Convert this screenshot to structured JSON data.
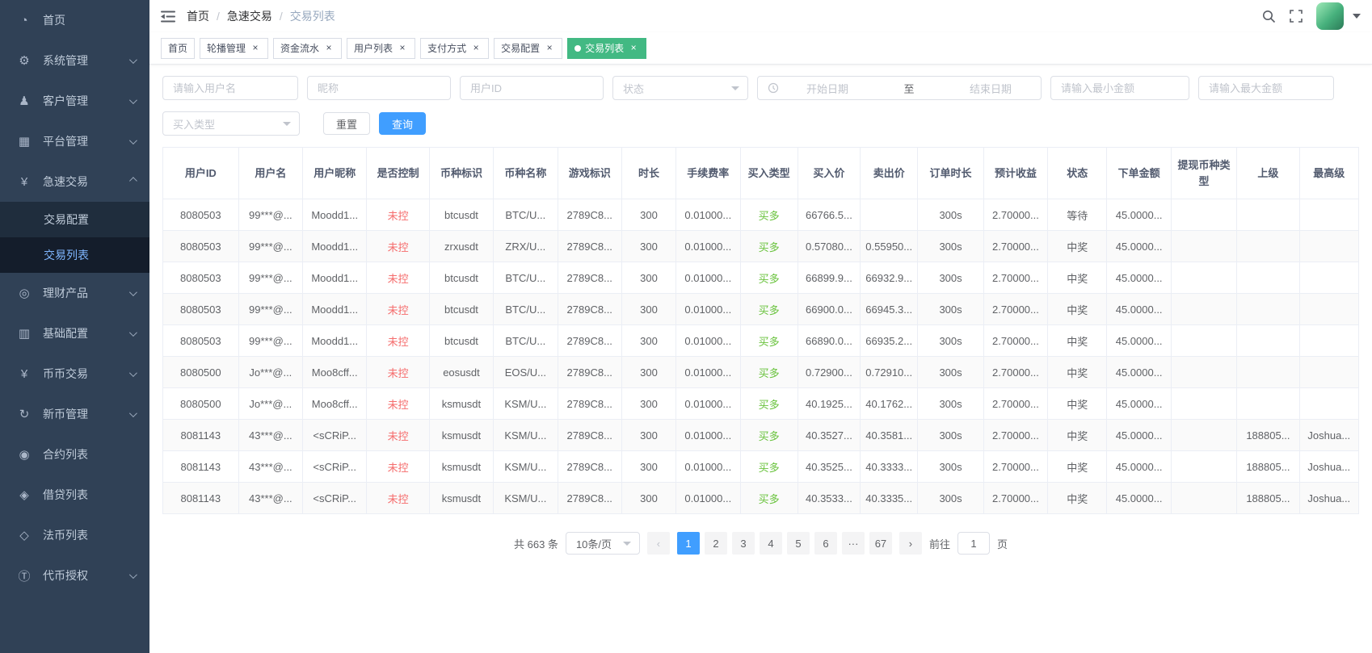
{
  "colors": {
    "primary": "#409EFF",
    "success": "#67C23A",
    "danger": "#F56C6C",
    "tag_active": "#42b983",
    "sidebar_bg": "#304156"
  },
  "sidebar": {
    "items": [
      {
        "label": "首页",
        "icon": "dashboard-icon",
        "glyph": "◔"
      },
      {
        "label": "系统管理",
        "icon": "gear-icon",
        "glyph": "⚙",
        "arrow": "down"
      },
      {
        "label": "客户管理",
        "icon": "user-icon",
        "glyph": "♟",
        "arrow": "down"
      },
      {
        "label": "平台管理",
        "icon": "grid-icon",
        "glyph": "▦",
        "arrow": "down"
      },
      {
        "label": "急速交易",
        "icon": "yen-icon",
        "glyph": "¥",
        "arrow": "up",
        "expanded": true,
        "children": [
          {
            "label": "交易配置",
            "active": false
          },
          {
            "label": "交易列表",
            "active": true
          }
        ]
      },
      {
        "label": "理财产品",
        "icon": "product-icon",
        "glyph": "◎",
        "arrow": "down"
      },
      {
        "label": "基础配置",
        "icon": "config-icon",
        "glyph": "▥",
        "arrow": "down"
      },
      {
        "label": "币币交易",
        "icon": "coin-trade-icon",
        "glyph": "¥",
        "arrow": "down"
      },
      {
        "label": "新币管理",
        "icon": "new-coin-icon",
        "glyph": "↻",
        "arrow": "down"
      },
      {
        "label": "合约列表",
        "icon": "contract-icon",
        "glyph": "◉"
      },
      {
        "label": "借贷列表",
        "icon": "loan-icon",
        "glyph": "◈"
      },
      {
        "label": "法币列表",
        "icon": "fiat-icon",
        "glyph": "◇"
      },
      {
        "label": "代币授权",
        "icon": "token-icon",
        "glyph": "Ⓣ",
        "arrow": "down"
      }
    ]
  },
  "header": {
    "breadcrumb": [
      "首页",
      "急速交易",
      "交易列表"
    ],
    "breadcrumb_separator": "/",
    "icons": [
      "hamburger-icon",
      "search-icon",
      "fullscreen-icon",
      "avatar",
      "caret-down-icon"
    ]
  },
  "tags": [
    {
      "label": "首页",
      "closable": false,
      "active": false
    },
    {
      "label": "轮播管理",
      "closable": true,
      "active": false
    },
    {
      "label": "资金流水",
      "closable": true,
      "active": false
    },
    {
      "label": "用户列表",
      "closable": true,
      "active": false
    },
    {
      "label": "支付方式",
      "closable": true,
      "active": false
    },
    {
      "label": "交易配置",
      "closable": true,
      "active": false
    },
    {
      "label": "交易列表",
      "closable": true,
      "active": true
    }
  ],
  "filters": {
    "username_placeholder": "请输入用户名",
    "nickname_placeholder": "昵称",
    "userid_placeholder": "用户ID",
    "status_placeholder": "状态",
    "date_start_placeholder": "开始日期",
    "date_separator": "至",
    "date_end_placeholder": "结束日期",
    "min_amount_placeholder": "请输入最小金额",
    "max_amount_placeholder": "请输入最大金额",
    "buy_type_placeholder": "买入类型",
    "reset_label": "重置",
    "search_label": "查询"
  },
  "table": {
    "columns": [
      "用户ID",
      "用户名",
      "用户昵称",
      "是否控制",
      "币种标识",
      "币种名称",
      "游戏标识",
      "时长",
      "手续费率",
      "买入类型",
      "买入价",
      "卖出价",
      "订单时长",
      "预计收益",
      "状态",
      "下单金额",
      "提现币种类型",
      "上级",
      "最高级"
    ],
    "rows": [
      [
        "8080503",
        "99***@...",
        "Moodd1...",
        "未控",
        "btcusdt",
        "BTC/U...",
        "2789C8...",
        "300",
        "0.01000...",
        "买多",
        "66766.5...",
        "",
        "300s",
        "2.70000...",
        "等待",
        "45.0000...",
        "",
        "",
        ""
      ],
      [
        "8080503",
        "99***@...",
        "Moodd1...",
        "未控",
        "zrxusdt",
        "ZRX/U...",
        "2789C8...",
        "300",
        "0.01000...",
        "买多",
        "0.57080...",
        "0.55950...",
        "300s",
        "2.70000...",
        "中奖",
        "45.0000...",
        "",
        "",
        ""
      ],
      [
        "8080503",
        "99***@...",
        "Moodd1...",
        "未控",
        "btcusdt",
        "BTC/U...",
        "2789C8...",
        "300",
        "0.01000...",
        "买多",
        "66899.9...",
        "66932.9...",
        "300s",
        "2.70000...",
        "中奖",
        "45.0000...",
        "",
        "",
        ""
      ],
      [
        "8080503",
        "99***@...",
        "Moodd1...",
        "未控",
        "btcusdt",
        "BTC/U...",
        "2789C8...",
        "300",
        "0.01000...",
        "买多",
        "66900.0...",
        "66945.3...",
        "300s",
        "2.70000...",
        "中奖",
        "45.0000...",
        "",
        "",
        ""
      ],
      [
        "8080503",
        "99***@...",
        "Moodd1...",
        "未控",
        "btcusdt",
        "BTC/U...",
        "2789C8...",
        "300",
        "0.01000...",
        "买多",
        "66890.0...",
        "66935.2...",
        "300s",
        "2.70000...",
        "中奖",
        "45.0000...",
        "",
        "",
        ""
      ],
      [
        "8080500",
        "Jo***@...",
        "Moo8cff...",
        "未控",
        "eosusdt",
        "EOS/U...",
        "2789C8...",
        "300",
        "0.01000...",
        "买多",
        "0.72900...",
        "0.72910...",
        "300s",
        "2.70000...",
        "中奖",
        "45.0000...",
        "",
        "",
        ""
      ],
      [
        "8080500",
        "Jo***@...",
        "Moo8cff...",
        "未控",
        "ksmusdt",
        "KSM/U...",
        "2789C8...",
        "300",
        "0.01000...",
        "买多",
        "40.1925...",
        "40.1762...",
        "300s",
        "2.70000...",
        "中奖",
        "45.0000...",
        "",
        "",
        ""
      ],
      [
        "8081143",
        "43***@...",
        "<sCRiP...",
        "未控",
        "ksmusdt",
        "KSM/U...",
        "2789C8...",
        "300",
        "0.01000...",
        "买多",
        "40.3527...",
        "40.3581...",
        "300s",
        "2.70000...",
        "中奖",
        "45.0000...",
        "",
        "188805...",
        "Joshua..."
      ],
      [
        "8081143",
        "43***@...",
        "<sCRiP...",
        "未控",
        "ksmusdt",
        "KSM/U...",
        "2789C8...",
        "300",
        "0.01000...",
        "买多",
        "40.3525...",
        "40.3333...",
        "300s",
        "2.70000...",
        "中奖",
        "45.0000...",
        "",
        "188805...",
        "Joshua..."
      ],
      [
        "8081143",
        "43***@...",
        "<sCRiP...",
        "未控",
        "ksmusdt",
        "KSM/U...",
        "2789C8...",
        "300",
        "0.01000...",
        "买多",
        "40.3533...",
        "40.3335...",
        "300s",
        "2.70000...",
        "中奖",
        "45.0000...",
        "",
        "188805...",
        "Joshua..."
      ]
    ]
  },
  "pagination": {
    "total_label": "共 663 条",
    "page_size": "10条/页",
    "prev_glyph": "‹",
    "next_glyph": "›",
    "pages": [
      "1",
      "2",
      "3",
      "4",
      "5",
      "6"
    ],
    "ellipsis": "···",
    "last_page": "67",
    "active_page": "1",
    "goto_label": "前往",
    "goto_value": "1",
    "page_label": "页"
  }
}
